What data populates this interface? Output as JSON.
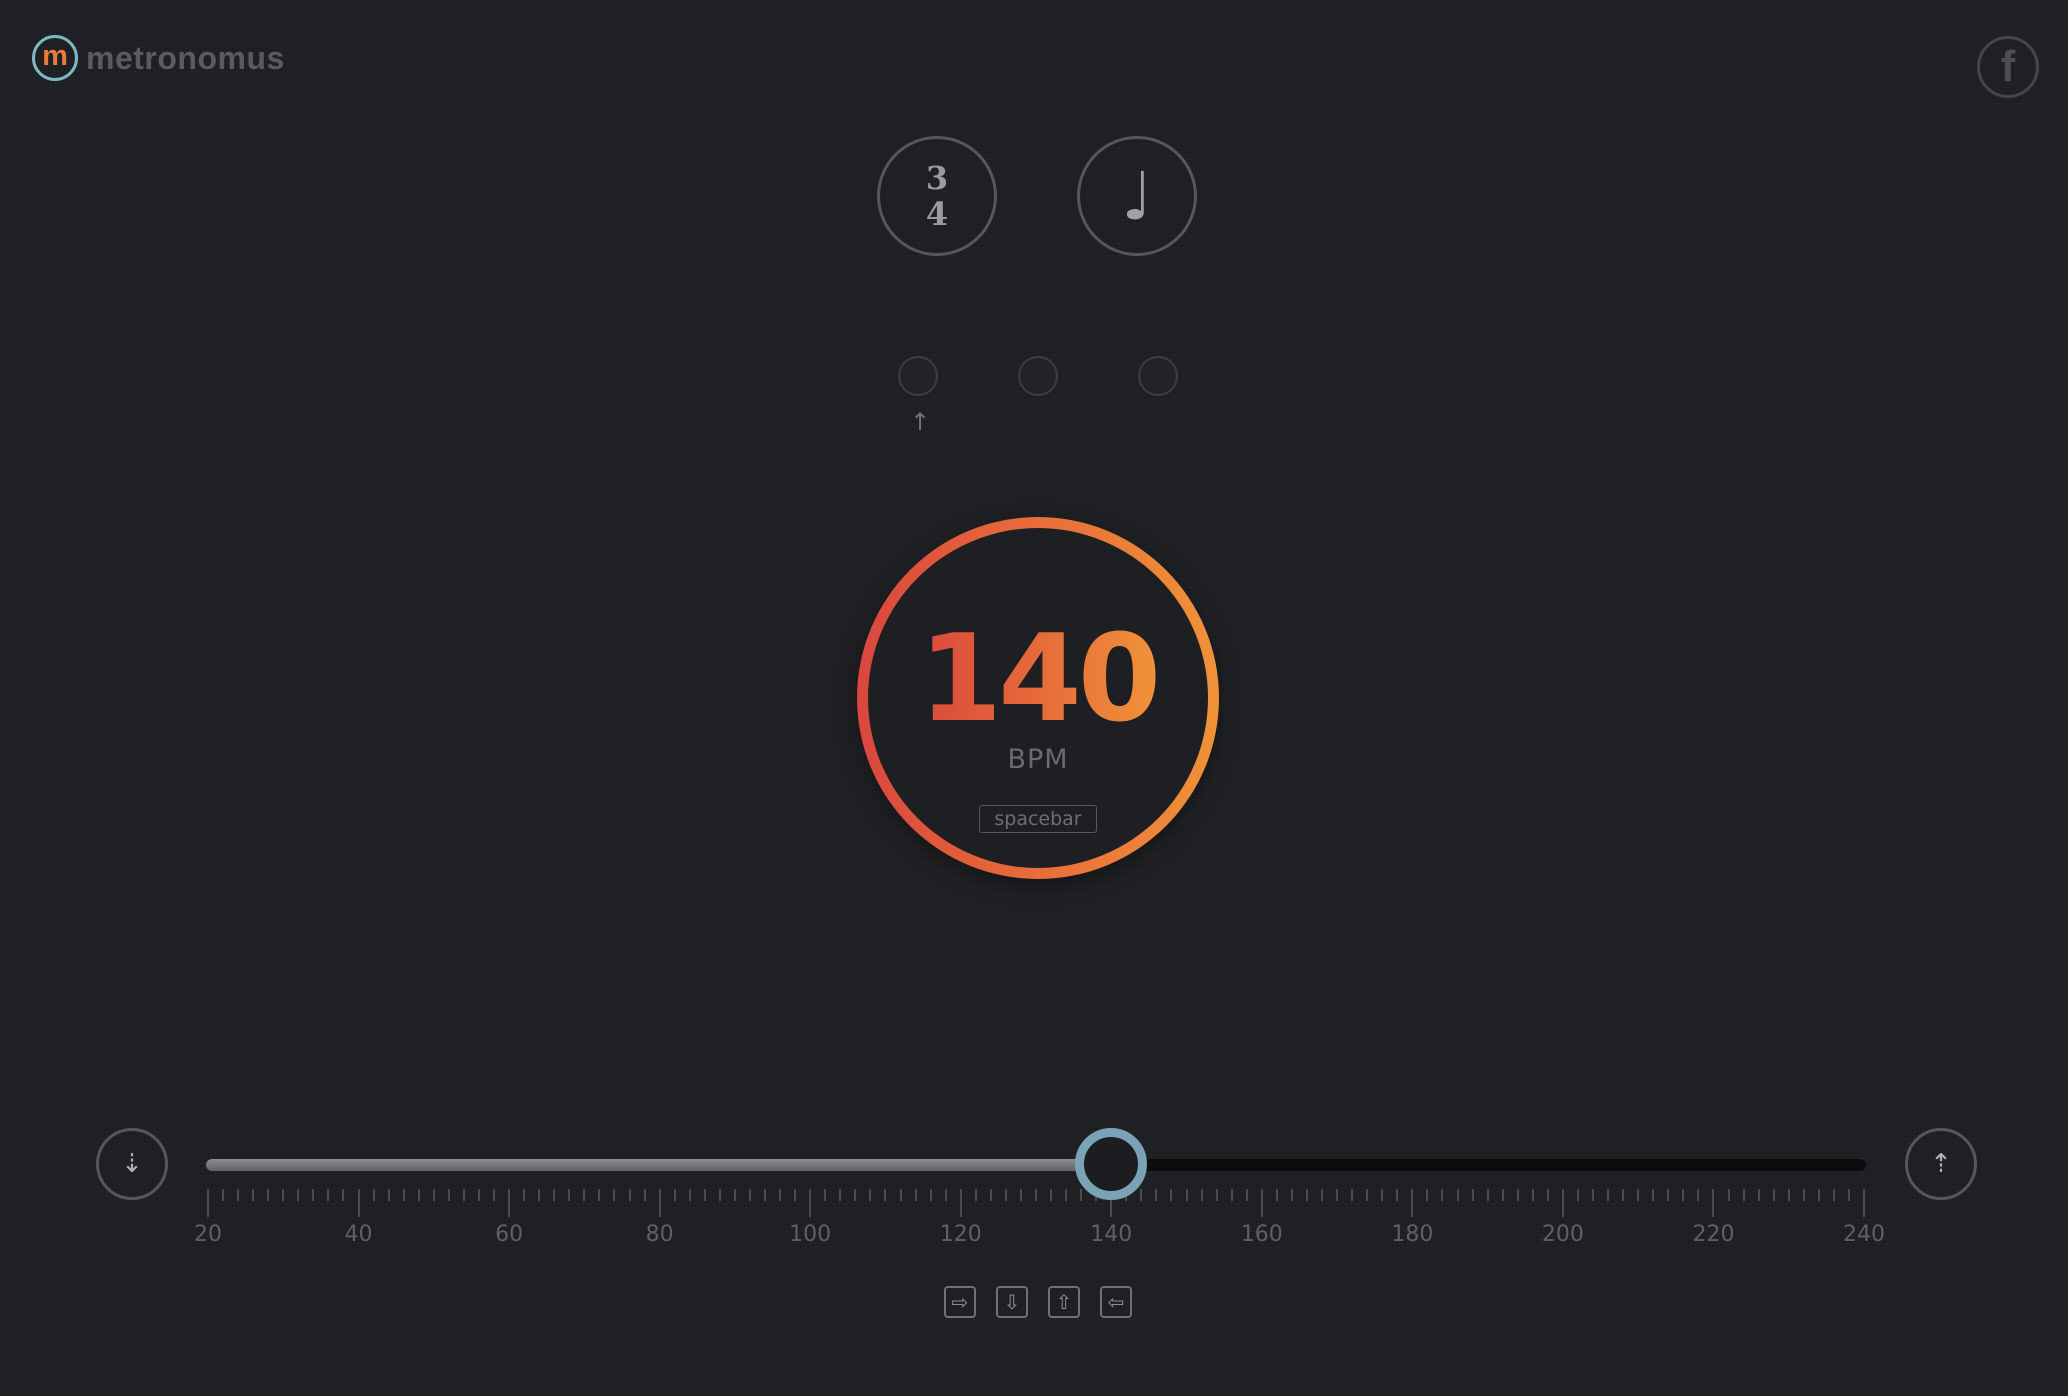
{
  "brand": {
    "logo_letter": "m",
    "name": "metronomus"
  },
  "social": {
    "facebook_glyph": "f"
  },
  "time_signature": {
    "numerator": "3",
    "denominator": "4"
  },
  "note_value": {
    "glyph": "♩",
    "name": "quarter-note"
  },
  "beats": {
    "count": 3,
    "accent_marker": "↑"
  },
  "tempo": {
    "value": "140",
    "unit": "BPM",
    "hotkey": "spacebar",
    "accent_colors": [
      "#d9463e",
      "#f09238"
    ]
  },
  "slider": {
    "min": 20,
    "max": 240,
    "value": 140,
    "major_step": 20,
    "minor_step": 2,
    "labels": [
      "20",
      "40",
      "60",
      "80",
      "100",
      "120",
      "140",
      "160",
      "180",
      "200",
      "220",
      "240"
    ],
    "decrease_glyph": "⇣",
    "increase_glyph": "⇡",
    "thumb_color": "#7aa3b8"
  },
  "keyboard_hints": [
    "⇨",
    "⇩",
    "⇧",
    "⇦"
  ]
}
